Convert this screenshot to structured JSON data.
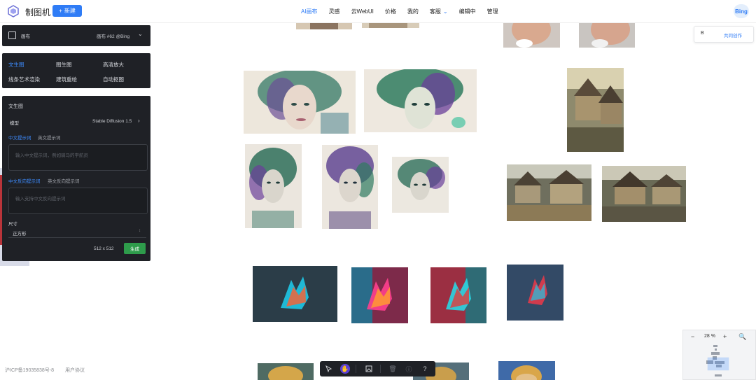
{
  "header": {
    "app_title": "制图机",
    "new_button_label": "新建",
    "nav": [
      "AI画布",
      "灵感",
      "云WebUI",
      "价格",
      "我的",
      "客服",
      "编辑中",
      "管理"
    ],
    "active_nav": "AI画布",
    "user_label": "Bing"
  },
  "canvas_panel": {
    "label": "画布",
    "canvas_name": "画布 #62 @Bing"
  },
  "modes": {
    "items": [
      "文生图",
      "图生图",
      "高清放大",
      "线条艺术渲染",
      "建筑重绘",
      "自动抠图"
    ],
    "active": "文生图"
  },
  "t2i": {
    "title": "文生图",
    "model_label": "模型",
    "model_value": "Stable Diffusion 1.5",
    "prompt_tabs": [
      "中文提示词",
      "英文提示词"
    ],
    "prompt_placeholder": "输入中文提示词，例如骑马的宇航员",
    "neg_tabs": [
      "中文反向提示词",
      "英文反向提示词"
    ],
    "neg_placeholder": "输入支持中文反向提示词",
    "size_label": "尺寸",
    "size_value": "正方形",
    "resolution": "512 x 512",
    "generate_label": "生成"
  },
  "collab": {
    "badge": "B",
    "label": "共同创作"
  },
  "zoom": {
    "level": "28 %"
  },
  "footer": {
    "icp": "沪ICP备19035838号-8",
    "terms": "用户协议"
  },
  "colors": {
    "accent": "#2f7cf6",
    "panel_bg": "#1f2126",
    "generate": "#2e9c4b",
    "toolbar_active": "#5b3fd6"
  }
}
